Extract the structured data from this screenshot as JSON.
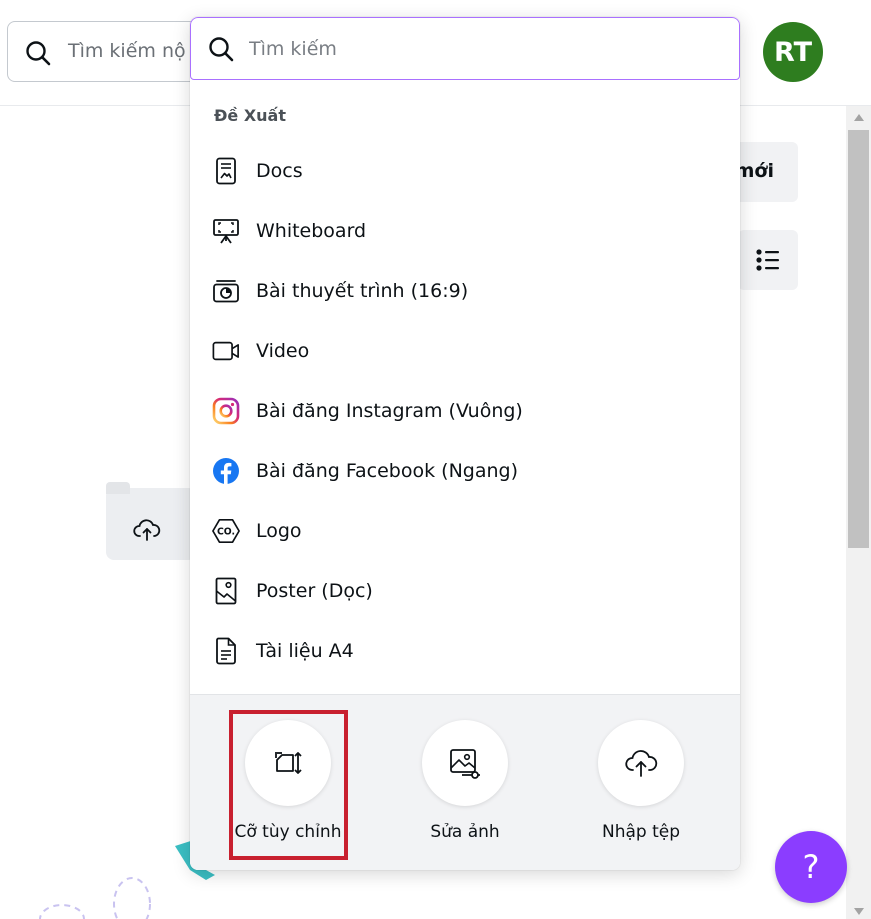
{
  "background": {
    "search_text": "Tìm kiếm nộ",
    "avatar_initials": "RT",
    "new_button_label": "mới",
    "help_label": "?"
  },
  "dropdown": {
    "search_placeholder": "Tìm kiếm",
    "section_title": "Đề Xuất",
    "items": [
      {
        "label": "Docs",
        "icon": "docs-icon"
      },
      {
        "label": "Whiteboard",
        "icon": "whiteboard-icon"
      },
      {
        "label": "Bài thuyết trình (16:9)",
        "icon": "presentation-icon"
      },
      {
        "label": "Video",
        "icon": "video-icon"
      },
      {
        "label": "Bài đăng Instagram (Vuông)",
        "icon": "instagram-icon"
      },
      {
        "label": "Bài đăng Facebook (Ngang)",
        "icon": "facebook-icon"
      },
      {
        "label": "Logo",
        "icon": "logo-icon"
      },
      {
        "label": "Poster (Dọc)",
        "icon": "poster-icon"
      },
      {
        "label": "Tài liệu A4",
        "icon": "document-icon"
      }
    ],
    "actions": [
      {
        "label": "Cỡ tùy chỉnh",
        "icon": "custom-size-icon"
      },
      {
        "label": "Sửa ảnh",
        "icon": "edit-photo-icon"
      },
      {
        "label": "Nhập tệp",
        "icon": "upload-icon"
      }
    ]
  },
  "colors": {
    "accent": "#8b3dff",
    "avatar": "#2e7d1f",
    "highlight": "#c8202f",
    "facebook": "#1877f2"
  }
}
